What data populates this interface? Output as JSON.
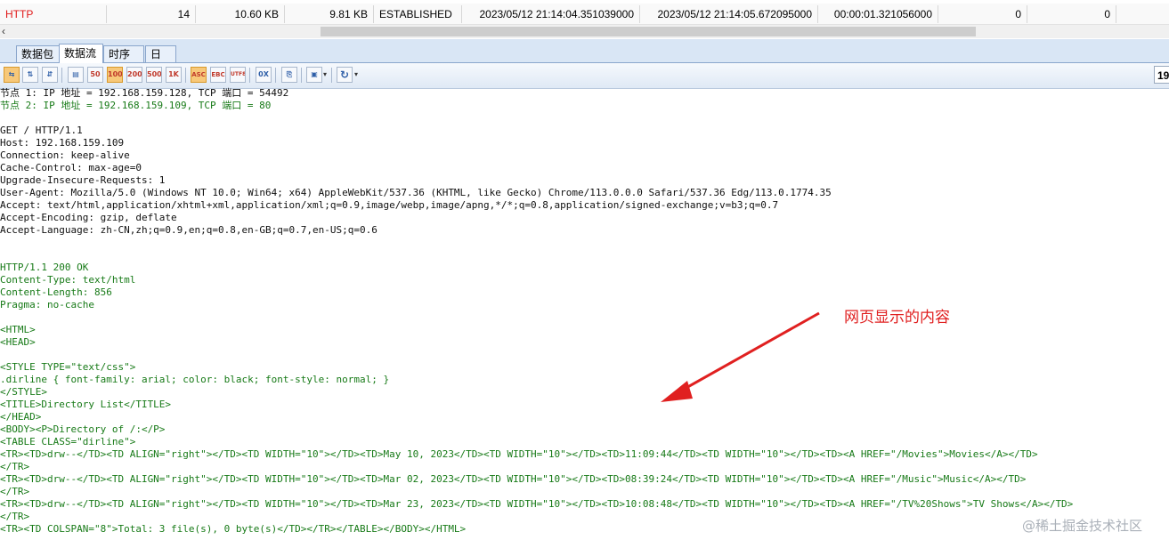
{
  "connection": {
    "protocol": "HTTP",
    "packets": "14",
    "bytes_a": "10.60 KB",
    "bytes_b": "9.81 KB",
    "state": "ESTABLISHED",
    "start_time": "2023/05/12 21:14:04.351039000",
    "end_time": "2023/05/12 21:14:05.672095000",
    "duration": "00:00:01.321056000",
    "val1": "0",
    "val2": "0"
  },
  "scrollbar": {
    "left_arrow": "‹"
  },
  "tabs": [
    {
      "label": "数据包"
    },
    {
      "label": "数据流"
    },
    {
      "label": "时序图"
    },
    {
      "label": "日志"
    }
  ],
  "toolbar": {
    "counter": "19",
    "buttons": [
      {
        "name": "swap-icon",
        "text": "⇆"
      },
      {
        "name": "order-1-2-icon",
        "text": "⇅"
      },
      {
        "name": "order-2-1-icon",
        "text": "⇵"
      },
      {
        "name": "packet-icon",
        "text": "▤"
      },
      {
        "name": "size-50-button",
        "text": "50"
      },
      {
        "name": "size-100-button",
        "text": "100"
      },
      {
        "name": "size-200-button",
        "text": "200"
      },
      {
        "name": "size-500-button",
        "text": "500"
      },
      {
        "name": "size-1k-button",
        "text": "1K"
      },
      {
        "name": "ascii-button",
        "text": "ASC"
      },
      {
        "name": "ebcdic-button",
        "text": "EBC"
      },
      {
        "name": "utf8-button",
        "text": "UTF8"
      },
      {
        "name": "hex-button",
        "text": "0X"
      },
      {
        "name": "copy-icon",
        "text": "⎘"
      },
      {
        "name": "save-image-icon",
        "text": "▣"
      },
      {
        "name": "refresh-icon",
        "text": "↻"
      }
    ],
    "colors": {
      "pressed": "#f7c879"
    }
  },
  "stream": {
    "lines": [
      {
        "text": "节点 1: IP 地址 = 192.168.159.128, TCP 端口 = 54492",
        "kind": "req"
      },
      {
        "text": "节点 2: IP 地址 = 192.168.159.109, TCP 端口 = 80",
        "kind": "resp"
      },
      {
        "text": "",
        "kind": "req"
      },
      {
        "text": "GET / HTTP/1.1",
        "kind": "req"
      },
      {
        "text": "Host: 192.168.159.109",
        "kind": "req"
      },
      {
        "text": "Connection: keep-alive",
        "kind": "req"
      },
      {
        "text": "Cache-Control: max-age=0",
        "kind": "req"
      },
      {
        "text": "Upgrade-Insecure-Requests: 1",
        "kind": "req"
      },
      {
        "text": "User-Agent: Mozilla/5.0 (Windows NT 10.0; Win64; x64) AppleWebKit/537.36 (KHTML, like Gecko) Chrome/113.0.0.0 Safari/537.36 Edg/113.0.1774.35",
        "kind": "req"
      },
      {
        "text": "Accept: text/html,application/xhtml+xml,application/xml;q=0.9,image/webp,image/apng,*/*;q=0.8,application/signed-exchange;v=b3;q=0.7",
        "kind": "req"
      },
      {
        "text": "Accept-Encoding: gzip, deflate",
        "kind": "req"
      },
      {
        "text": "Accept-Language: zh-CN,zh;q=0.9,en;q=0.8,en-GB;q=0.7,en-US;q=0.6",
        "kind": "req"
      },
      {
        "text": "",
        "kind": "req"
      },
      {
        "text": "",
        "kind": "req"
      },
      {
        "text": "HTTP/1.1 200 OK",
        "kind": "resp"
      },
      {
        "text": "Content-Type: text/html",
        "kind": "resp"
      },
      {
        "text": "Content-Length: 856",
        "kind": "resp"
      },
      {
        "text": "Pragma: no-cache",
        "kind": "resp"
      },
      {
        "text": "",
        "kind": "resp"
      },
      {
        "text": "<HTML>",
        "kind": "resp"
      },
      {
        "text": "<HEAD>",
        "kind": "resp"
      },
      {
        "text": "",
        "kind": "resp"
      },
      {
        "text": "<STYLE TYPE=\"text/css\">",
        "kind": "resp"
      },
      {
        "text": ".dirline { font-family: arial; color: black; font-style: normal; }",
        "kind": "resp"
      },
      {
        "text": "</STYLE>",
        "kind": "resp"
      },
      {
        "text": "<TITLE>Directory List</TITLE>",
        "kind": "resp"
      },
      {
        "text": "</HEAD>",
        "kind": "resp"
      },
      {
        "text": "<BODY><P>Directory of /:</P>",
        "kind": "resp"
      },
      {
        "text": "<TABLE CLASS=\"dirline\">",
        "kind": "resp"
      },
      {
        "text": "<TR><TD>drw--</TD><TD ALIGN=\"right\"></TD><TD WIDTH=\"10\"></TD><TD>May 10, 2023</TD><TD WIDTH=\"10\"></TD><TD>11:09:44</TD><TD WIDTH=\"10\"></TD><TD><A HREF=\"/Movies\">Movies</A></TD>",
        "kind": "resp"
      },
      {
        "text": "</TR>",
        "kind": "resp"
      },
      {
        "text": "<TR><TD>drw--</TD><TD ALIGN=\"right\"></TD><TD WIDTH=\"10\"></TD><TD>Mar 02, 2023</TD><TD WIDTH=\"10\"></TD><TD>08:39:24</TD><TD WIDTH=\"10\"></TD><TD><A HREF=\"/Music\">Music</A></TD>",
        "kind": "resp"
      },
      {
        "text": "</TR>",
        "kind": "resp"
      },
      {
        "text": "<TR><TD>drw--</TD><TD ALIGN=\"right\"></TD><TD WIDTH=\"10\"></TD><TD>Mar 23, 2023</TD><TD WIDTH=\"10\"></TD><TD>10:08:48</TD><TD WIDTH=\"10\"></TD><TD><A HREF=\"/TV%20Shows\">TV Shows</A></TD>",
        "kind": "resp"
      },
      {
        "text": "</TR>",
        "kind": "resp"
      },
      {
        "text": "<TR><TD COLSPAN=\"8\">Total: 3 file(s), 0 byte(s)</TD></TR></TABLE></BODY></HTML>",
        "kind": "resp"
      }
    ]
  },
  "annotation": {
    "text": "网页显示的内容",
    "color": "#e02020"
  },
  "watermark": "@稀土掘金技术社区"
}
